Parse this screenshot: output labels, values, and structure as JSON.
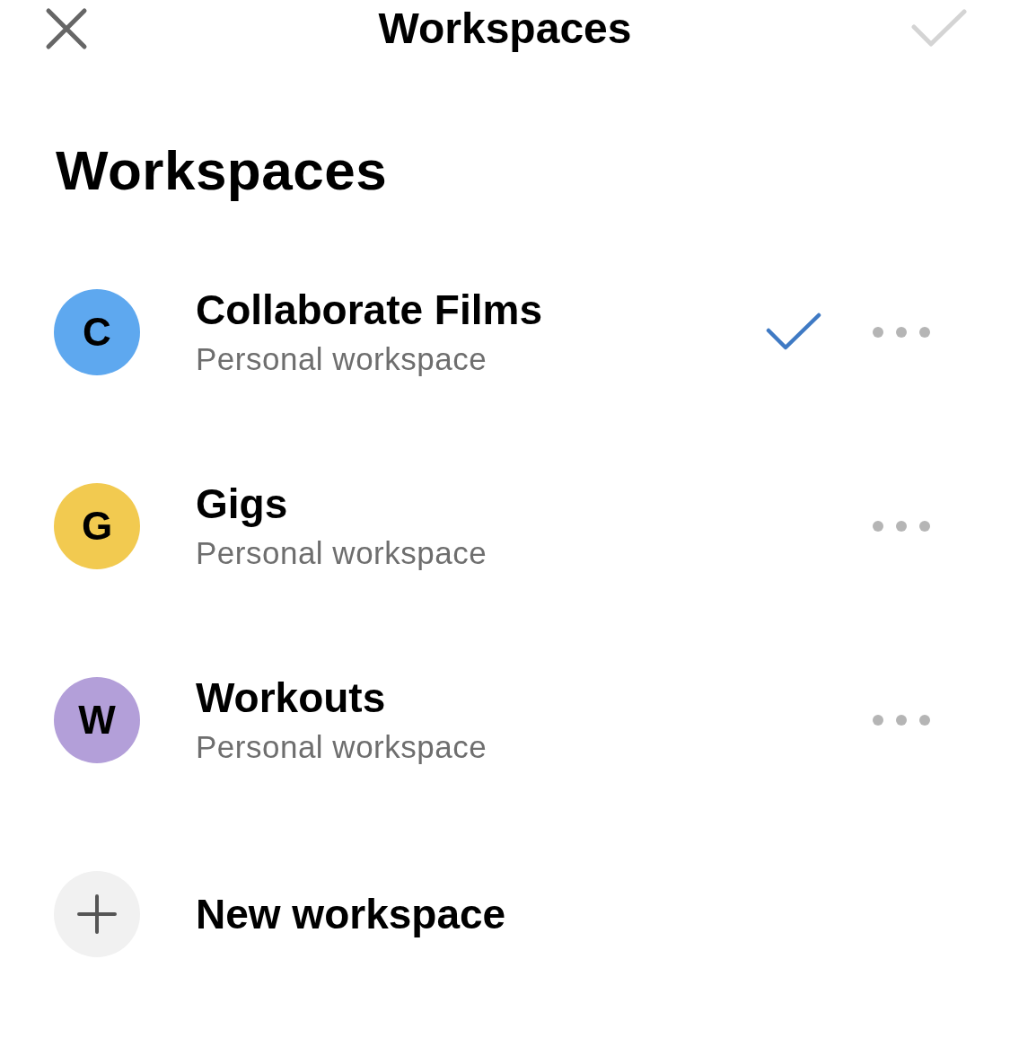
{
  "header": {
    "title": "Workspaces",
    "confirm_enabled": false
  },
  "heading": "Workspaces",
  "workspaces": [
    {
      "initial": "C",
      "name": "Collaborate Films",
      "subtitle": "Personal workspace",
      "color": "#5ea8ef",
      "selected": true
    },
    {
      "initial": "G",
      "name": "Gigs",
      "subtitle": "Personal workspace",
      "color": "#f2ca50",
      "selected": false
    },
    {
      "initial": "W",
      "name": "Workouts",
      "subtitle": "Personal workspace",
      "color": "#b39fd9",
      "selected": false
    }
  ],
  "new_workspace": {
    "label": "New workspace"
  }
}
